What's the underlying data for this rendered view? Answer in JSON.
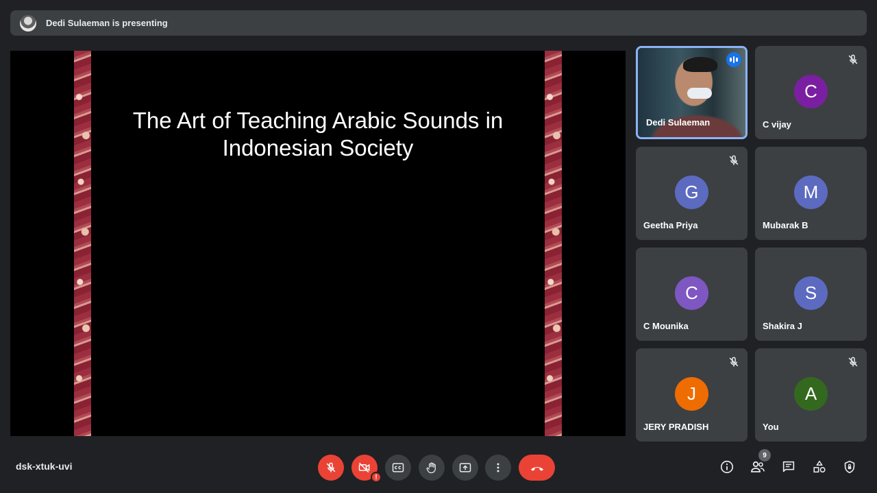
{
  "banner": {
    "text": "Dedi Sulaeman is presenting"
  },
  "slide": {
    "title_line1": "The Art of Teaching Arabic Sounds in",
    "title_line2": "Indonesian Society"
  },
  "participants": [
    {
      "name": "Dedi Sulaeman",
      "initial": "",
      "color": "",
      "muted": false,
      "video": true,
      "speaking": true
    },
    {
      "name": "C vijay",
      "initial": "C",
      "color": "#7b1fa2",
      "muted": true
    },
    {
      "name": "Geetha Priya",
      "initial": "G",
      "color": "#5c6bc0",
      "muted": true
    },
    {
      "name": "Mubarak B",
      "initial": "M",
      "color": "#5c6bc0",
      "muted": false
    },
    {
      "name": "C Mounika",
      "initial": "C",
      "color": "#7e57c2",
      "muted": false
    },
    {
      "name": "Shakira J",
      "initial": "S",
      "color": "#5c6bc0",
      "muted": false
    },
    {
      "name": "JERY PRADISH",
      "initial": "J",
      "color": "#ef6c00",
      "muted": true
    },
    {
      "name": "You",
      "initial": "A",
      "color": "#33691e",
      "muted": true
    }
  ],
  "meeting": {
    "code": "dsk-xtuk-uvi",
    "participant_count": "9",
    "camera_alert": "!"
  },
  "controls": {
    "mic": "mic-off-icon",
    "camera": "camera-off-icon",
    "captions": "captions-icon",
    "hand": "raise-hand-icon",
    "present": "present-screen-icon",
    "more": "more-vert-icon",
    "end": "call-end-icon"
  },
  "right_controls": [
    "info-icon",
    "people-icon",
    "chat-icon",
    "activities-icon",
    "host-controls-icon"
  ],
  "colors": {
    "danger": "#ea4335",
    "surface": "#3c4043",
    "background": "#202124",
    "speaking": "#1a73e8"
  }
}
